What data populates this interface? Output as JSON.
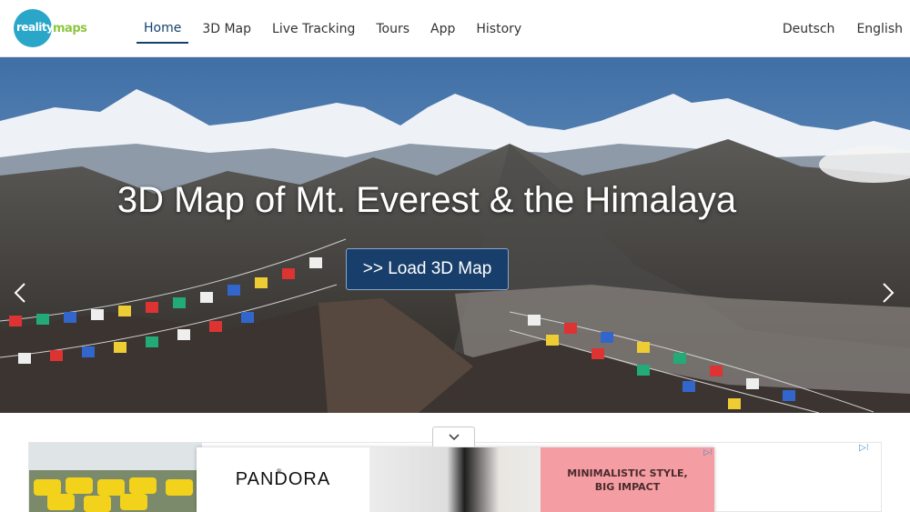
{
  "logo": {
    "circle_text": "reality",
    "word": "maps"
  },
  "nav": {
    "items": [
      {
        "label": "Home",
        "active": true
      },
      {
        "label": "3D Map"
      },
      {
        "label": "Live Tracking"
      },
      {
        "label": "Tours"
      },
      {
        "label": "App"
      },
      {
        "label": "History"
      }
    ]
  },
  "lang": {
    "de": "Deutsch",
    "en": "English"
  },
  "hero": {
    "title": "3D Map of Mt. Everest & the Himalaya",
    "button": ">> Load 3D Map",
    "slide_count": 3,
    "active_slide": 1
  },
  "ad": {
    "brand": "PANDORA",
    "brand_mark": "♛",
    "tagline_line1": "MINIMALISTIC STYLE,",
    "tagline_line2": "BIG IMPACT",
    "choices": "▷⁝",
    "choices_outer": "▷⁝"
  },
  "colors": {
    "accent": "#14406e",
    "button_bg": "#183e6b",
    "logo_circle": "#2aa6c9",
    "logo_green": "#8cc63f",
    "ad_pink": "#f49da3"
  }
}
